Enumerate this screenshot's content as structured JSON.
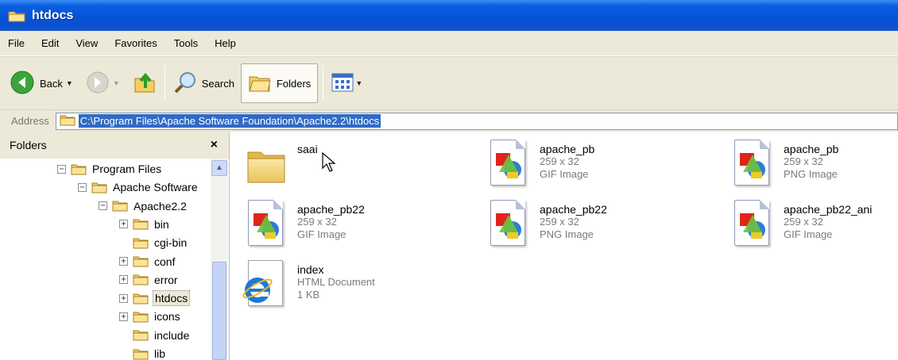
{
  "window": {
    "title": "htdocs",
    "title_icon": "folder-icon"
  },
  "menu": [
    "File",
    "Edit",
    "View",
    "Favorites",
    "Tools",
    "Help"
  ],
  "toolbar": {
    "back_label": "Back",
    "search_label": "Search",
    "folders_label": "Folders"
  },
  "address": {
    "label": "Address",
    "value": "C:\\Program Files\\Apache Software Foundation\\Apache2.2\\htdocs"
  },
  "folders_pane": {
    "title": "Folders",
    "close": "×",
    "tree": [
      {
        "label": "Program Files",
        "expander": "minus",
        "selected": false
      },
      {
        "label": "Apache Software",
        "expander": "minus",
        "selected": false
      },
      {
        "label": "Apache2.2",
        "expander": "minus",
        "selected": false
      },
      {
        "label": "bin",
        "expander": "plus",
        "selected": false
      },
      {
        "label": "cgi-bin",
        "expander": "none",
        "selected": false
      },
      {
        "label": "conf",
        "expander": "plus",
        "selected": false
      },
      {
        "label": "error",
        "expander": "plus",
        "selected": false
      },
      {
        "label": "htdocs",
        "expander": "plus",
        "selected": true
      },
      {
        "label": "icons",
        "expander": "plus",
        "selected": false
      },
      {
        "label": "include",
        "expander": "none",
        "selected": false
      },
      {
        "label": "lib",
        "expander": "none",
        "selected": false
      }
    ]
  },
  "files": [
    {
      "name": "saai",
      "line1": "",
      "line2": "",
      "icon": "folder-icon"
    },
    {
      "name": "apache_pb",
      "line1": "259 x 32",
      "line2": "GIF Image",
      "icon": "image-file-icon"
    },
    {
      "name": "apache_pb",
      "line1": "259 x 32",
      "line2": "PNG Image",
      "icon": "image-file-icon"
    },
    {
      "name": "apache_pb22",
      "line1": "259 x 32",
      "line2": "GIF Image",
      "icon": "image-file-icon"
    },
    {
      "name": "apache_pb22",
      "line1": "259 x 32",
      "line2": "PNG Image",
      "icon": "image-file-icon"
    },
    {
      "name": "apache_pb22_ani",
      "line1": "259 x 32",
      "line2": "GIF Image",
      "icon": "image-file-icon"
    },
    {
      "name": "index",
      "line1": "HTML Document",
      "line2": "1 KB",
      "icon": "html-document-icon"
    }
  ],
  "colors": {
    "titlebar": "#0654d8",
    "chrome": "#ece9d8",
    "address_selection": "#316ac5"
  }
}
